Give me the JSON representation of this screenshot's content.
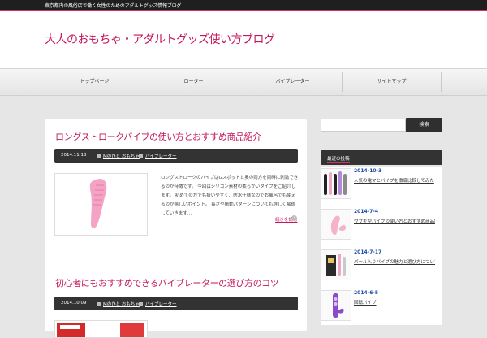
{
  "topbar": {
    "tagline": "東京都内の風俗店で働く女性のためのアダルトグッズ情報ブログ"
  },
  "header": {
    "site_title": "大人のおもちゃ・アダルトグッズ使い方ブログ"
  },
  "nav": {
    "items": [
      {
        "label": "トップページ"
      },
      {
        "label": "ローター"
      },
      {
        "label": "バイブレーター"
      },
      {
        "label": "サイトマップ"
      }
    ]
  },
  "posts": [
    {
      "title": "ロングストロークバイブの使い方とおすすめ商品紹介",
      "date": "2014.11.13",
      "author": "Mのひと おもちゃ",
      "category": "バイブレーター",
      "excerpt": "ロングストロークのバイブはGスポットと奥の両方を同時に刺激できるのが特徴です。 今回はシリコン素材の柔らかいタイプをご紹介します。 初めての方でも扱いやすく、防水仕様なのでお風呂でも使えるのが嬉しいポイント。 長さや振動パターンについても詳しく解説していきます…",
      "more_label": "続きを読む"
    },
    {
      "title": "初心者にもおすすめできるバイブレーターの選び方のコツ",
      "date": "2014.10.09",
      "author": "Mのひと おもちゃ",
      "category": "バイブレーター"
    }
  ],
  "search": {
    "placeholder": "",
    "button_label": "検索"
  },
  "sidebar": {
    "widget_title": "最近の投稿",
    "items": [
      {
        "date": "2014-10-3",
        "title": "人気の電マとバイブを徹底比較してみた"
      },
      {
        "date": "2014-7-4",
        "title": "ウサギ型バイブの使い方とおすすめ商品紹介"
      },
      {
        "date": "2014-7-17",
        "title": "パール入りバイブの魅力と選び方について"
      },
      {
        "date": "2014-6-5",
        "title": "回転バイブ"
      }
    ]
  },
  "colors": {
    "accent": "#c4165a",
    "dark": "#333333",
    "link_blue": "#1a4aa8"
  }
}
